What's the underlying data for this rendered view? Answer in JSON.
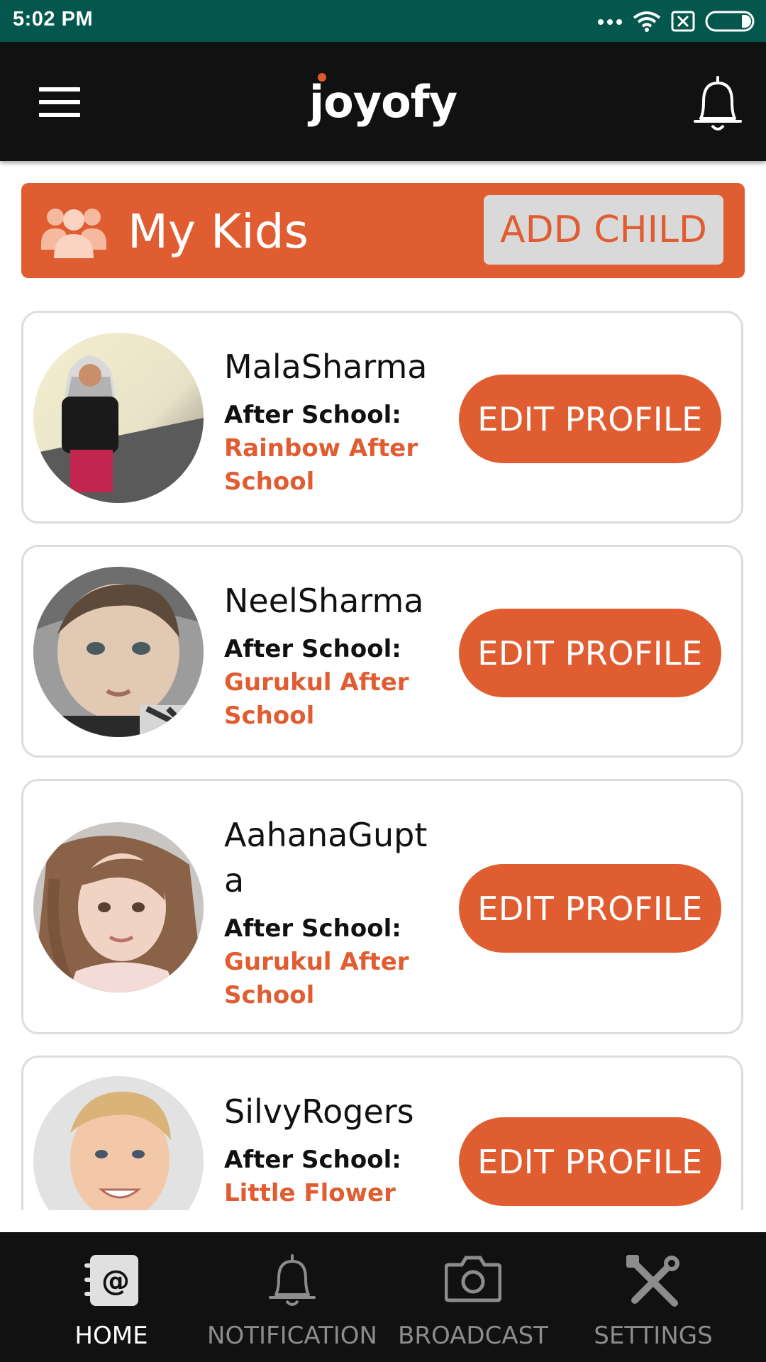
{
  "status_bar": {
    "time": "5:02 PM"
  },
  "app_bar": {
    "logo": "joyofy"
  },
  "my_kids": {
    "title": "My Kids",
    "add_button": "ADD CHILD"
  },
  "kids": [
    {
      "name": "MalaSharma",
      "after_label": "After School:",
      "school": "Rainbow After School",
      "button": "EDIT PROFILE"
    },
    {
      "name": "NeelSharma",
      "after_label": "After School:",
      "school": "Gurukul After School",
      "button": "EDIT PROFILE"
    },
    {
      "name": "AahanaGupta",
      "after_label": "After School:",
      "school": "Gurukul After School",
      "button": "EDIT PROFILE"
    },
    {
      "name": "SilvyRogers",
      "after_label": "After School:",
      "school": "Little Flower",
      "button": "EDIT PROFILE"
    }
  ],
  "bottom_nav": [
    {
      "label": "HOME",
      "icon": "contact-book-icon",
      "active": true
    },
    {
      "label": "NOTIFICATION",
      "icon": "bell-icon",
      "active": false
    },
    {
      "label": "BROADCAST",
      "icon": "camera-icon",
      "active": false
    },
    {
      "label": "SETTINGS",
      "icon": "tools-icon",
      "active": false
    }
  ],
  "colors": {
    "accent": "#e05d31",
    "status_bar": "#03574d",
    "app_bar": "#111111",
    "button_gray": "#d9d9d9"
  }
}
